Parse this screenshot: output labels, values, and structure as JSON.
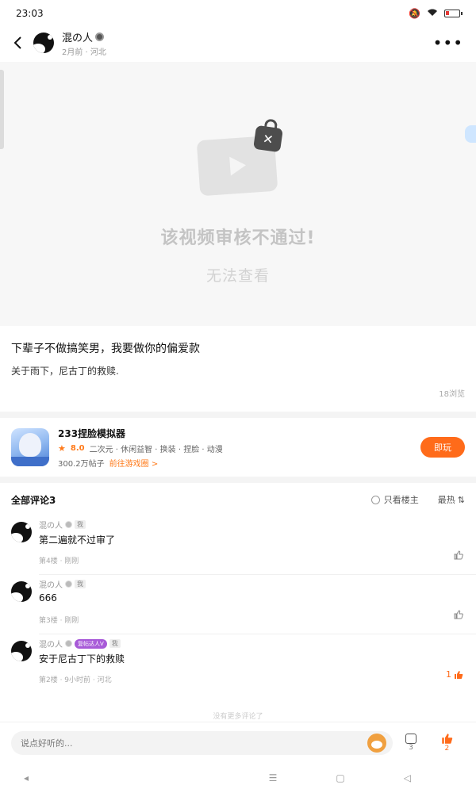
{
  "status_bar": {
    "time": "23:03"
  },
  "header": {
    "author": "混の人",
    "meta": "2月前 · 河北",
    "more": "•••"
  },
  "video": {
    "status_title": "该视频审核不通过!",
    "status_sub": "无法查看"
  },
  "post": {
    "title": "下辈子不做搞笑男，我要做你的偏爱款",
    "body": "关于雨下，尼古丁的救赎.",
    "views": "18浏览"
  },
  "game": {
    "name": "233捏脸模拟器",
    "rating": "8.0",
    "tags": "二次元 · 休闲益智 · 换装 · 捏脸 · 动漫",
    "posts": "300.2万帖子",
    "link": "前往游戏圈 >",
    "play_button": "即玩"
  },
  "comments": {
    "title": "全部评论3",
    "only_author": "只看楼主",
    "sort": "最热",
    "sort_icon": "⇅",
    "items": [
      {
        "author": "混の人",
        "me": "我",
        "text": "第二遍就不过审了",
        "meta": "第4楼 · 刚刚",
        "likes": ""
      },
      {
        "author": "混の人",
        "me": "我",
        "text": "666",
        "meta": "第3楼 · 刚刚",
        "likes": ""
      },
      {
        "author": "混の人",
        "level": "复帖达人V",
        "me": "我",
        "text": "安于尼古丁下的救赎",
        "meta": "第2楼 · 9小时前 · 河北",
        "likes": "1"
      }
    ],
    "no_more": "没有更多评论了"
  },
  "input_bar": {
    "placeholder": "说点好听的...",
    "comment_count": "3",
    "like_count": "2"
  },
  "colors": {
    "accent": "#ff6b1a",
    "level_badge": "#a85ad8"
  },
  "icons": [
    "back-arrow",
    "more-dots",
    "lock",
    "play",
    "star",
    "thumb-up",
    "comment-bubble",
    "mascot"
  ]
}
